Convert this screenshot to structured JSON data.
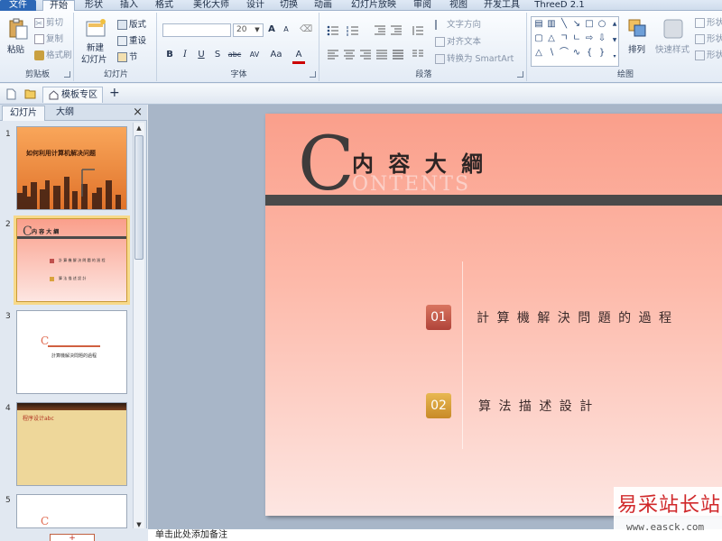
{
  "menu": {
    "tabs": [
      "文件",
      "开始",
      "形状",
      "插入",
      "格式",
      "美化大师",
      "设计",
      "切换",
      "动画",
      "幻灯片放映",
      "审阅",
      "视图",
      "开发工具",
      "ThreeD 2.1"
    ]
  },
  "ribbon": {
    "clipboard": {
      "paste": "粘贴",
      "cut": "剪切",
      "copy": "复制",
      "format_painter": "格式刷",
      "label": "剪贴板"
    },
    "slides": {
      "new_slide": "新建",
      "new_slide2": "幻灯片",
      "layout": "版式",
      "reset": "重设",
      "section": "节",
      "label": "幻灯片"
    },
    "font": {
      "font_name": "",
      "font_size": "20",
      "bold": "B",
      "italic": "I",
      "underline": "U",
      "strike": "S",
      "shadow": "abc",
      "spacing": "AV",
      "case": "Aa",
      "color": "A",
      "grow": "A",
      "shrink": "A",
      "label": "字体"
    },
    "paragraph": {
      "text_direction": "文字方向",
      "align_text": "对齐文本",
      "smartart": "转换为 SmartArt",
      "label": "段落"
    },
    "drawing": {
      "arrange": "排列",
      "quick_styles": "快速样式",
      "shape_fill": "形状",
      "shape_outline": "形状",
      "shape_effect": "形状",
      "label": "绘图"
    }
  },
  "quickbar": {
    "tab_label": "模板专区",
    "add": "+"
  },
  "panel": {
    "tab_slides": "幻灯片",
    "tab_outline": "大纲",
    "close": "×"
  },
  "thumbnails": [
    {
      "num": "1",
      "title": "如何利用计算机解决问题"
    },
    {
      "num": "2",
      "title": "内 容 大 綱",
      "item1": "計 算 機 解 決 問 題 的 過 程",
      "item2": "算 法 描 述 設 計"
    },
    {
      "num": "3",
      "title": "C",
      "subtitle": "計算機解決問題的過程"
    },
    {
      "num": "4",
      "title": "程序设计abc"
    },
    {
      "num": "5",
      "title": "C"
    }
  ],
  "slide": {
    "big_letter": "C",
    "title": "内 容 大 綱",
    "subtitle": "ONTENTS",
    "items": [
      {
        "num": "01",
        "text": "計 算 機 解 決 問 題 的 過 程"
      },
      {
        "num": "02",
        "text": "算 法 描 述 設 計"
      }
    ]
  },
  "notes": {
    "placeholder": "单击此处添加备注",
    "add_button": "+"
  },
  "watermark": {
    "line1": "易采站长站",
    "line2": "www.easck.com"
  },
  "colors": {
    "file_tab": "#2c67b6",
    "slide_top": "#fa9f8b",
    "slide_bottom": "#fde6e2",
    "num1": "#c0504d",
    "num2": "#d9a23c",
    "bar": "#4a4a4a"
  }
}
